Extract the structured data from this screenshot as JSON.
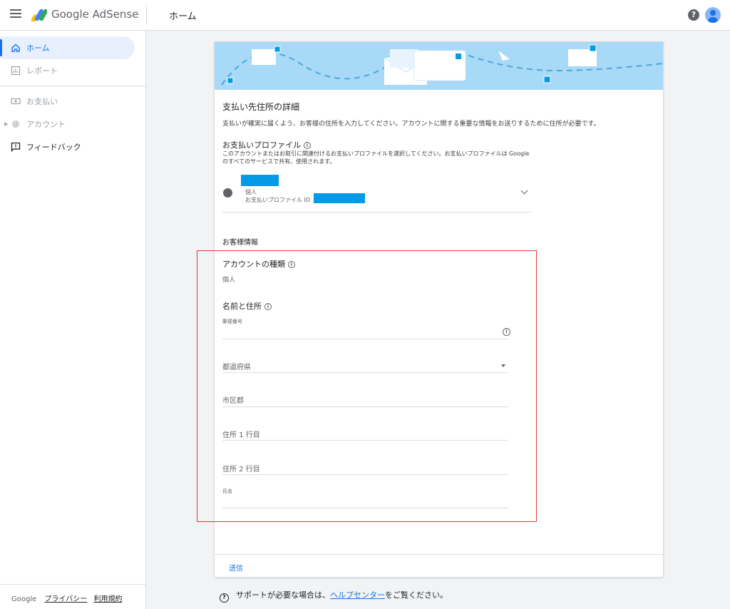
{
  "app": {
    "brand": "Google AdSense",
    "page_title": "ホーム"
  },
  "header": {
    "help_icon": "help-circle-icon",
    "avatar_icon": "account-avatar-icon",
    "help_glyph": "?"
  },
  "sidebar": {
    "items": [
      {
        "label": "ホーム",
        "icon": "home-icon",
        "state": "active"
      },
      {
        "label": "レポート",
        "icon": "bar-chart-icon",
        "state": "disabled"
      },
      {
        "label": "お支払い",
        "icon": "payment-icon",
        "state": "disabled"
      },
      {
        "label": "アカウント",
        "icon": "gear-icon",
        "state": "disabled"
      },
      {
        "label": "フィードバック",
        "icon": "feedback-icon",
        "state": "normal"
      }
    ],
    "footer": {
      "google": "Google",
      "privacy": "プライバシー",
      "terms": "利用規約"
    }
  },
  "form": {
    "title": "支払い先住所の詳細",
    "description": "支払いが確実に届くよう、お客様の住所を入力してください。アカウントに関する重要な情報をお送りするために住所が必要です。",
    "profile": {
      "title": "お支払いプロファイル",
      "description": "このアカウントまたはお取引に関連付けるお支払いプロファイルを選択してください。お支払いプロファイルは Google のすべてのサービスで共有、使用されます。",
      "type": "個人",
      "id_label": "お支払いプロファイル ID"
    },
    "customer_info": "お客様情報",
    "account_type": {
      "label": "アカウントの種類",
      "value": "個人"
    },
    "name_address": "名前と住所",
    "fields": {
      "postal_code": "郵便番号",
      "prefecture": "都道府県",
      "city": "市区郡",
      "address1": "住所 1 行目",
      "address2": "住所 2 行目",
      "name": "氏名"
    },
    "info_glyph": "i",
    "submit": "送信"
  },
  "support": {
    "prefix": "サポートが必要な場合は、",
    "link": "ヘルプセンター",
    "suffix": "をご覧ください。"
  },
  "colors": {
    "accent": "#1a73e8",
    "redaction": "#039be5",
    "highlight_border": "#e53935",
    "banner": "#a8daf7"
  }
}
